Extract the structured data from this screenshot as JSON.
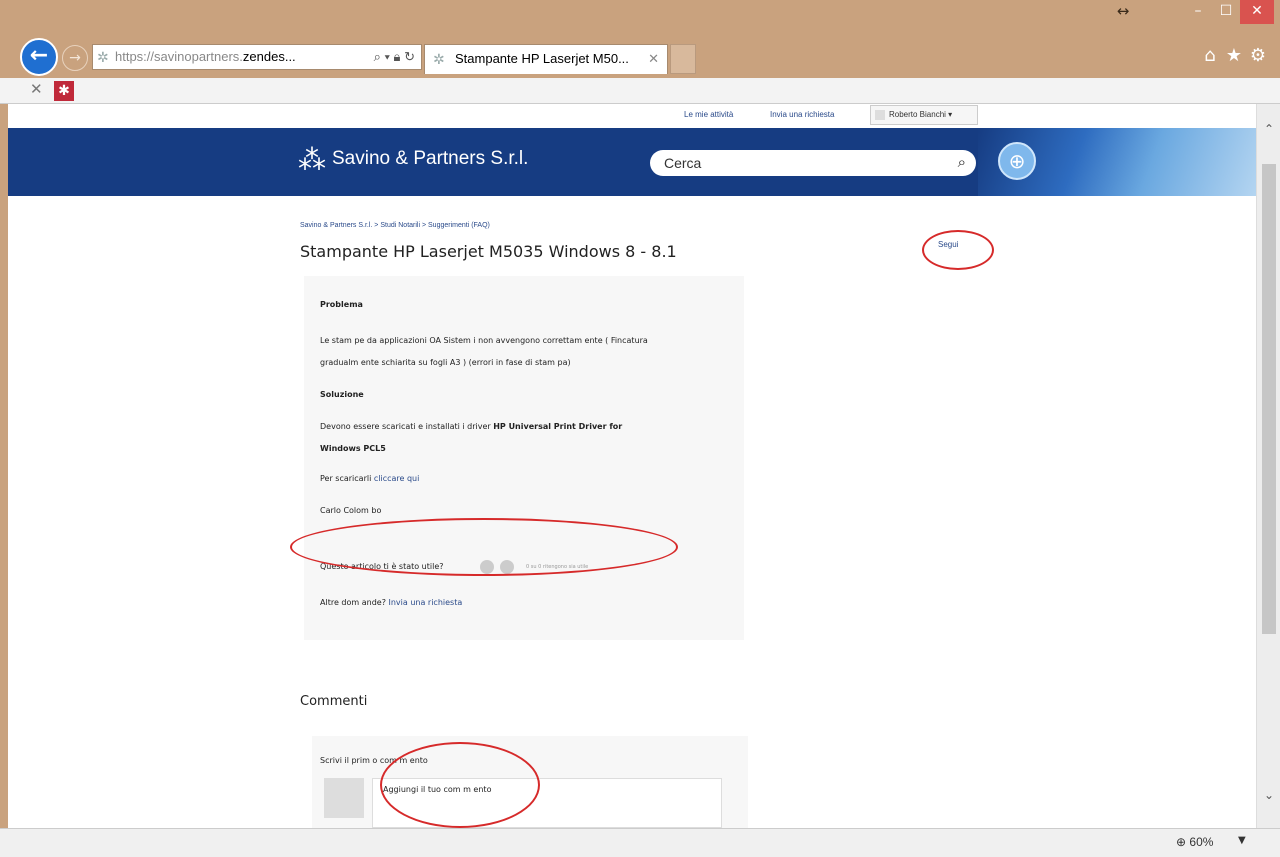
{
  "browser": {
    "url_prefix": "https://savinopartners.",
    "url_domain": "zendes...",
    "tab_title": "Stampante HP Laserjet M50...",
    "zoom": "60%"
  },
  "page": {
    "top_links": {
      "activities": "Le mie attività",
      "submit_request": "Invia una richiesta",
      "user": "Roberto Bianchi"
    },
    "brand": "Savino & Partners S.r.l.",
    "search_placeholder": "Cerca",
    "breadcrumb": "Savino & Partners S.r.l. > Studi Notarili > Suggerimenti (FAQ)",
    "title": "Stampante HP Laserjet M5035 Windows 8 - 8.1",
    "follow": "Segui",
    "article": {
      "problem_heading": "Problema",
      "problem_line1": "Le stam pe da applicazioni OA Sistem i non avvengono correttam ente ( Fincatura",
      "problem_line2": "gradualm ente schiarita su fogli A3 ) (errori in fase di stam pa)",
      "solution_heading": "Soluzione",
      "solution_line1_pre": "Devono essere scaricati e installati i driver ",
      "solution_line1_bold": "HP Universal Print Driver for",
      "solution_line2": "Windows PCL5",
      "download_pre": "Per scaricarli ",
      "download_link": "cliccare qui",
      "author": "Carlo Colom bo",
      "vote_question": "Questo articolo ti è stato utile?",
      "vote_count": "0 su 0 ritengono sia utile",
      "other_questions": "Altre dom ande? ",
      "submit_request_link": "Invia una richiesta"
    },
    "comments_title": "Commenti",
    "first_comment": "Scrivi il prim o com m ento",
    "comment_placeholder": "Aggiungi il tuo com m ento"
  }
}
